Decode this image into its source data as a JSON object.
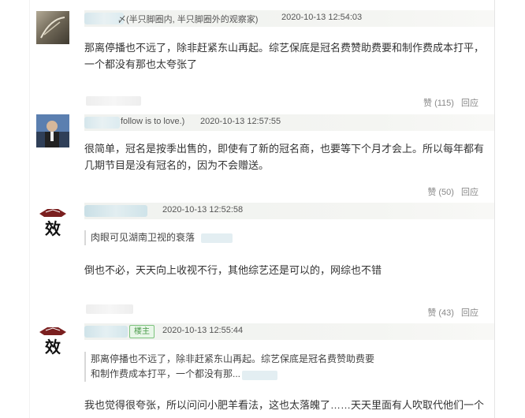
{
  "comments": [
    {
      "user_suffix": "〆(半只脚圈内, 半只脚圈外的观察家)",
      "time": "2020-10-13 12:54:03",
      "text": "那离停播也不远了，除非赶紧东山再起。综艺保底是冠名费赞助费要和制作费成本打平，一个都没有那也太夸张了",
      "likes": "赞 (115)",
      "reply": "回应"
    },
    {
      "user_suffix": "follow is to love.)",
      "time": "2020-10-13 12:57:55",
      "text": "很简单，冠名是按季出售的，即使有了新的冠名商，也要等下个月才会上。所以每年都有几期节目是没有冠名的，因为不会赠送。",
      "likes": "赞 (50)",
      "reply": "回应"
    },
    {
      "time": "2020-10-13 12:52:58",
      "quote": "肉眼可见湖南卫视的衰落",
      "text": "倒也不必，天天向上收视不行，其他综艺还是可以的，网综也不错",
      "likes": "赞 (43)",
      "reply": "回应"
    },
    {
      "badge": "楼主",
      "time": "2020-10-13 12:55:44",
      "quote_line1": "那离停播也不远了，除非赶紧东山再起。综艺保底是冠名费赞助费要",
      "quote_line2": "和制作费成本打平，一个都没有那...",
      "text": "我也觉得很夸张，所以问问小肥羊看法，这也太落魄了……天天里面有人吹取代他们一个"
    }
  ],
  "avatar_glyph": "效"
}
